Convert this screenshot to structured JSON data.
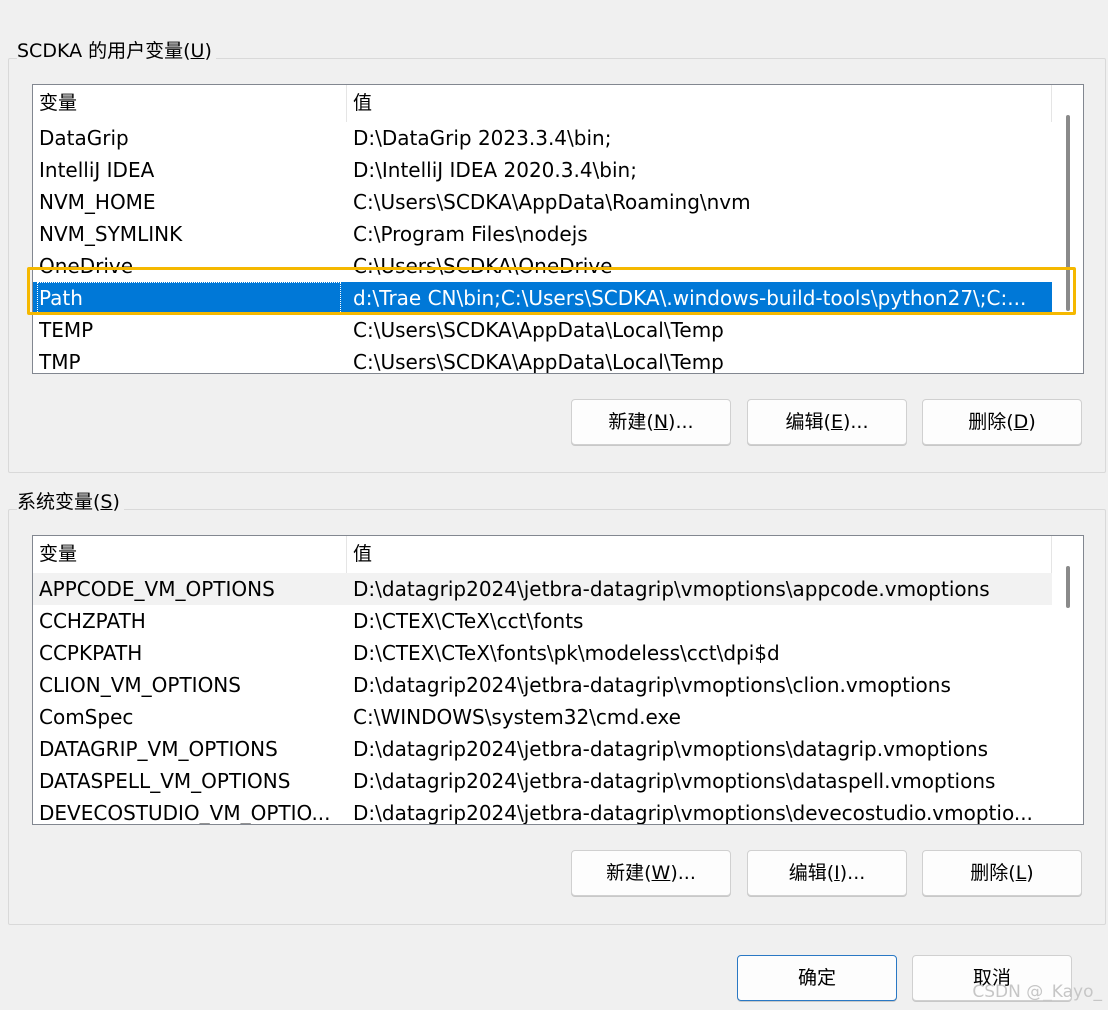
{
  "user_vars": {
    "title_prefix": "SCDKA 的用户变量(",
    "title_key": "U",
    "title_suffix": ")",
    "header": {
      "name": "变量",
      "value": "值"
    },
    "rows": [
      {
        "name": "DataGrip",
        "value": "D:\\DataGrip 2023.3.4\\bin;"
      },
      {
        "name": "IntelliJ IDEA",
        "value": "D:\\IntelliJ IDEA 2020.3.4\\bin;"
      },
      {
        "name": "NVM_HOME",
        "value": "C:\\Users\\SCDKA\\AppData\\Roaming\\nvm"
      },
      {
        "name": "NVM_SYMLINK",
        "value": "C:\\Program Files\\nodejs"
      },
      {
        "name": "OneDrive",
        "value": "C:\\Users\\SCDKA\\OneDrive"
      },
      {
        "name": "Path",
        "value": "d:\\Trae CN\\bin;C:\\Users\\SCDKA\\.windows-build-tools\\python27\\;C:..."
      },
      {
        "name": "TEMP",
        "value": "C:\\Users\\SCDKA\\AppData\\Local\\Temp"
      },
      {
        "name": "TMP",
        "value": "C:\\Users\\SCDKA\\AppData\\Local\\Temp"
      }
    ],
    "selected_index": 5,
    "buttons": {
      "new": {
        "pre": "新建(",
        "key": "N",
        "post": ")..."
      },
      "edit": {
        "pre": "编辑(",
        "key": "E",
        "post": ")..."
      },
      "delete": {
        "pre": "删除(",
        "key": "D",
        "post": ")"
      }
    }
  },
  "system_vars": {
    "title_prefix": "系统变量(",
    "title_key": "S",
    "title_suffix": ")",
    "header": {
      "name": "变量",
      "value": "值"
    },
    "rows": [
      {
        "name": "APPCODE_VM_OPTIONS",
        "value": "D:\\datagrip2024\\jetbra-datagrip\\vmoptions\\appcode.vmoptions"
      },
      {
        "name": "CCHZPATH",
        "value": "D:\\CTEX\\CTeX\\cct\\fonts"
      },
      {
        "name": "CCPKPATH",
        "value": "D:\\CTEX\\CTeX\\fonts\\pk\\modeless\\cct\\dpi$d"
      },
      {
        "name": "CLION_VM_OPTIONS",
        "value": "D:\\datagrip2024\\jetbra-datagrip\\vmoptions\\clion.vmoptions"
      },
      {
        "name": "ComSpec",
        "value": "C:\\WINDOWS\\system32\\cmd.exe"
      },
      {
        "name": "DATAGRIP_VM_OPTIONS",
        "value": "D:\\datagrip2024\\jetbra-datagrip\\vmoptions\\datagrip.vmoptions"
      },
      {
        "name": "DATASPELL_VM_OPTIONS",
        "value": "D:\\datagrip2024\\jetbra-datagrip\\vmoptions\\dataspell.vmoptions"
      },
      {
        "name": "DEVECOSTUDIO_VM_OPTIO...",
        "value": "D:\\datagrip2024\\jetbra-datagrip\\vmoptions\\devecostudio.vmoptio..."
      }
    ],
    "buttons": {
      "new": {
        "pre": "新建(",
        "key": "W",
        "post": ")..."
      },
      "edit": {
        "pre": "编辑(",
        "key": "I",
        "post": ")..."
      },
      "delete": {
        "pre": "删除(",
        "key": "L",
        "post": ")"
      }
    }
  },
  "dialog_buttons": {
    "ok": "确定",
    "cancel": "取消"
  },
  "watermark": "CSDN @_Kayo_",
  "colors": {
    "selection": "#0078d7",
    "highlight_box": "#f5b800"
  }
}
